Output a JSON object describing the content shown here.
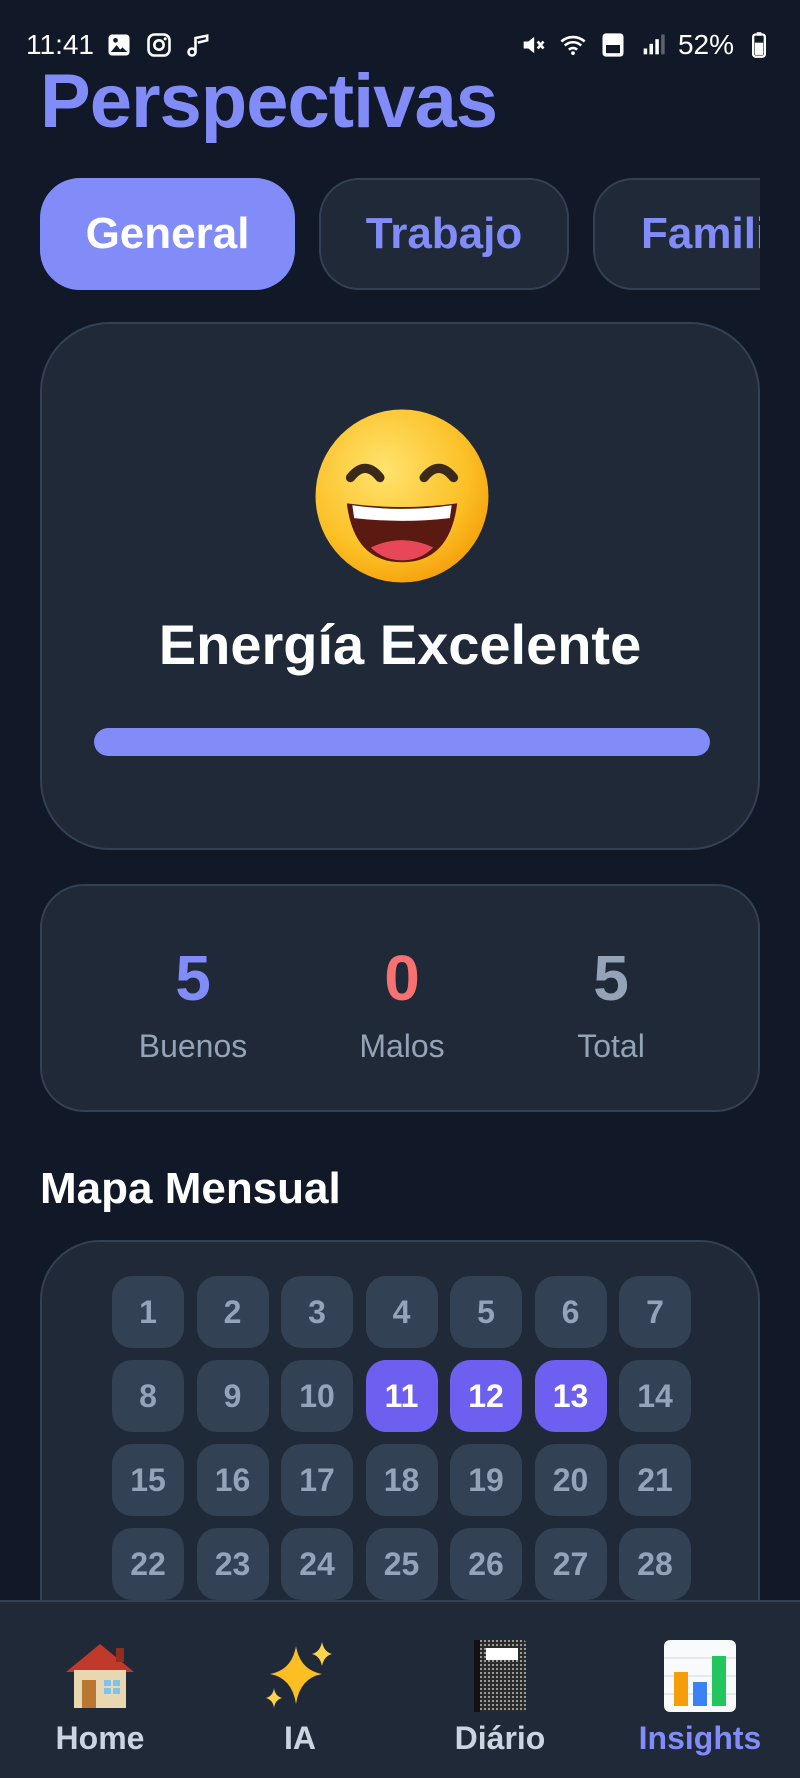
{
  "status_bar": {
    "time": "11:41",
    "battery": "52%"
  },
  "page_title": "Perspectivas",
  "tabs": [
    {
      "label": "General",
      "active": true
    },
    {
      "label": "Trabajo",
      "active": false
    },
    {
      "label": "Famili",
      "active": false
    }
  ],
  "mood": {
    "emoji": "grinning-face-smiling-eyes-icon",
    "title": "Energía Excelente",
    "level": 1.0
  },
  "stats": [
    {
      "value": "5",
      "label": "Buenos",
      "color": "#818cf8"
    },
    {
      "value": "0",
      "label": "Malos",
      "color": "#f87171"
    },
    {
      "value": "5",
      "label": "Total",
      "color": "#94a3b8"
    }
  ],
  "calendar": {
    "title": "Mapa Mensual",
    "days": [
      "1",
      "2",
      "3",
      "4",
      "5",
      "6",
      "7",
      "8",
      "9",
      "10",
      "11",
      "12",
      "13",
      "14",
      "15",
      "16",
      "17",
      "18",
      "19",
      "20",
      "21",
      "22",
      "23",
      "24",
      "25",
      "26",
      "27",
      "28"
    ],
    "highlighted": [
      "11",
      "12",
      "13"
    ]
  },
  "nav": [
    {
      "label": "Home",
      "icon": "house-icon",
      "active": false
    },
    {
      "label": "IA",
      "icon": "sparkles-icon",
      "active": false
    },
    {
      "label": "Diário",
      "icon": "notebook-icon",
      "active": false
    },
    {
      "label": "Insights",
      "icon": "bar-chart-icon",
      "active": true
    }
  ],
  "colors": {
    "accent": "#818cf8",
    "background": "#111827",
    "card": "#1f2937",
    "highlight_day": "#6d5ff0"
  }
}
